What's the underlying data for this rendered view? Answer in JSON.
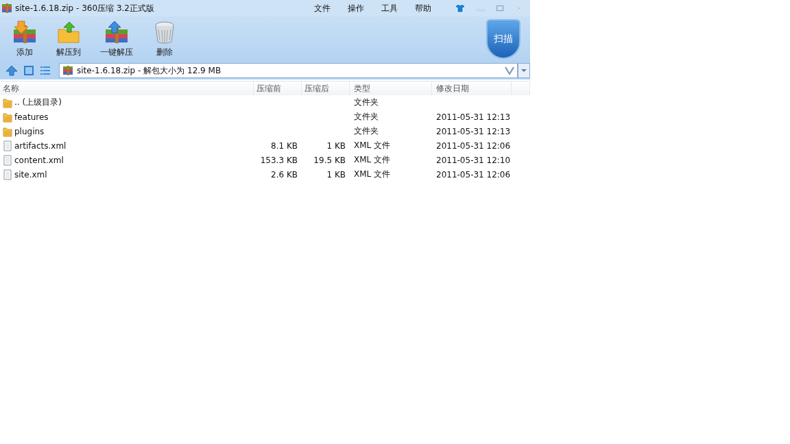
{
  "window": {
    "title": "site-1.6.18.zip - 360压缩 3.2正式版"
  },
  "menu": [
    "文件",
    "操作",
    "工具",
    "帮助"
  ],
  "toolbar": [
    {
      "label": "添加",
      "kind": "add"
    },
    {
      "label": "解压到",
      "kind": "extract"
    },
    {
      "label": "一键解压",
      "kind": "quick"
    },
    {
      "label": "删除",
      "kind": "delete"
    }
  ],
  "scan_button": {
    "label": "扫描"
  },
  "address_bar": {
    "value": "site-1.6.18.zip - 解包大小为 12.9 MB"
  },
  "table": {
    "columns": [
      "名称",
      "压缩前",
      "压缩后",
      "类型",
      "修改日期"
    ],
    "rows": [
      {
        "kind": "folder",
        "cells": [
          ".. (上级目录)",
          "",
          "",
          "文件夹",
          ""
        ]
      },
      {
        "kind": "folder",
        "cells": [
          "features",
          "",
          "",
          "文件夹",
          "2011-05-31 12:13"
        ]
      },
      {
        "kind": "folder",
        "cells": [
          "plugins",
          "",
          "",
          "文件夹",
          "2011-05-31 12:13"
        ]
      },
      {
        "kind": "file",
        "cells": [
          "artifacts.xml",
          "8.1 KB",
          "1 KB",
          "XML 文件",
          "2011-05-31 12:06"
        ]
      },
      {
        "kind": "file",
        "cells": [
          "content.xml",
          "153.3 KB",
          "19.5 KB",
          "XML 文件",
          "2011-05-31 12:10"
        ]
      },
      {
        "kind": "file",
        "cells": [
          "site.xml",
          "2.6 KB",
          "1 KB",
          "XML 文件",
          "2011-05-31 12:06"
        ]
      }
    ]
  }
}
